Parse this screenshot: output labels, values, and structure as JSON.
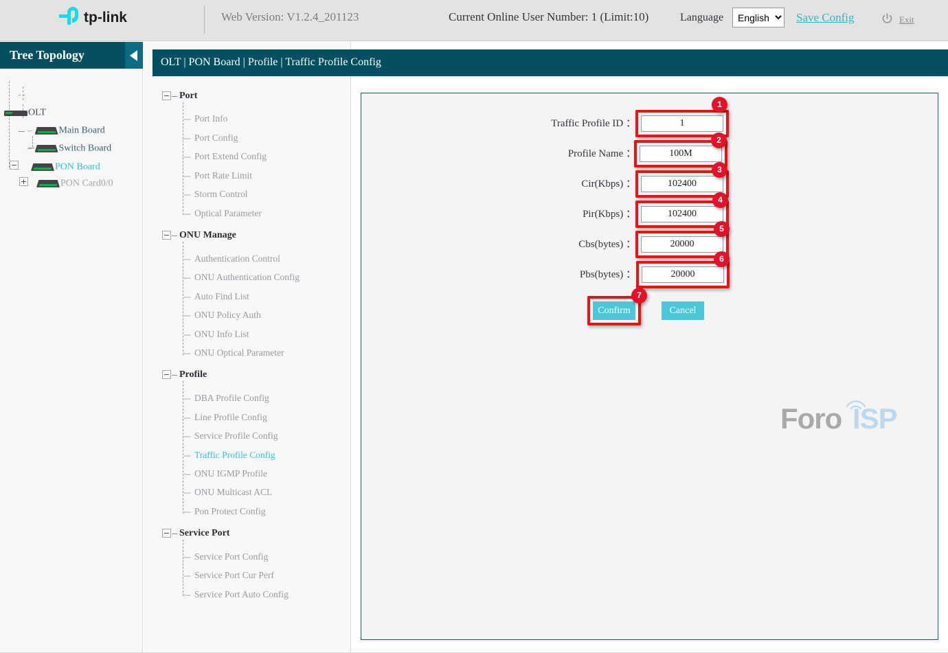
{
  "header": {
    "logo_text": "tp-link",
    "web_version": "Web Version: V1.2.4_201123",
    "online_user": "Current Online User Number: 1 (Limit:10)",
    "language_label": "Language",
    "language_value": "English",
    "language_options": [
      "English"
    ],
    "save_config": "Save Config",
    "exit": "Exit",
    "power_icon": "power-icon",
    "accent_color": "#31b6c4",
    "bar_color": "#e3e3e3"
  },
  "tree": {
    "title": "Tree Topology",
    "collapse_icon": "chevron-left-icon",
    "header_color": "#044f62",
    "nodes": [
      {
        "label": "OLT",
        "toggle": "none",
        "icon": "device-icon"
      },
      {
        "label": "Main Board",
        "toggle": "none",
        "icon": "device-icon"
      },
      {
        "label": "Switch Board",
        "toggle": "none",
        "icon": "device-icon"
      },
      {
        "label": "PON Board",
        "toggle": "minus",
        "icon": "device-icon",
        "active": true
      },
      {
        "label": "PON Card0/0",
        "toggle": "plus",
        "icon": "device-icon",
        "dim": true
      }
    ]
  },
  "nav": {
    "groups": [
      {
        "title": "Port",
        "toggle": "minus",
        "items": [
          "Port Info",
          "Port Config",
          "Port Extend Config",
          "Port Rate Limit",
          "Storm Control",
          "Optical Parameter"
        ]
      },
      {
        "title": "ONU Manage",
        "toggle": "minus",
        "items": [
          "Authentication Control",
          "ONU Authentication Config",
          "Auto Find List",
          "ONU Policy Auth",
          "ONU Info List",
          "ONU Optical Parameter"
        ]
      },
      {
        "title": "Profile",
        "toggle": "minus",
        "items": [
          "DBA Profile Config",
          "Line Profile Config",
          "Service Profile Config",
          "Traffic Profile Config",
          "ONU IGMP Profile",
          "ONU Multicast ACL",
          "Pon Protect Config"
        ],
        "active_item": "Traffic Profile Config"
      },
      {
        "title": "Service Port",
        "toggle": "minus",
        "items": [
          "Service Port Config",
          "Service Port Cur Perf",
          "Service Port Auto Config"
        ]
      }
    ]
  },
  "breadcrumb": "OLT | PON Board | Profile | Traffic Profile Config",
  "form": {
    "fields": [
      {
        "label": "Traffic Profile ID",
        "value": "1",
        "badge": "1",
        "highlighted": true
      },
      {
        "label": "Profile Name",
        "value": "100M",
        "badge": "2",
        "highlighted": true
      },
      {
        "label": "Cir(Kbps)",
        "value": "102400",
        "badge": "3",
        "highlighted": true
      },
      {
        "label": "Pir(Kbps)",
        "value": "102400",
        "badge": "4",
        "highlighted": true
      },
      {
        "label": "Cbs(bytes)",
        "value": "20000",
        "badge": "5",
        "highlighted": true
      },
      {
        "label": "Pbs(bytes)",
        "value": "20000",
        "badge": "6",
        "highlighted": true
      }
    ],
    "colon": "：",
    "confirm_label": "Confirm",
    "cancel_label": "Cancel",
    "confirm_badge": "7",
    "button_color": "#4bc8d8",
    "highlight_color": "#ee1111"
  },
  "watermark": {
    "text_primary": "Foro",
    "text_secondary": "ISP",
    "icon": "wifi-icon"
  }
}
